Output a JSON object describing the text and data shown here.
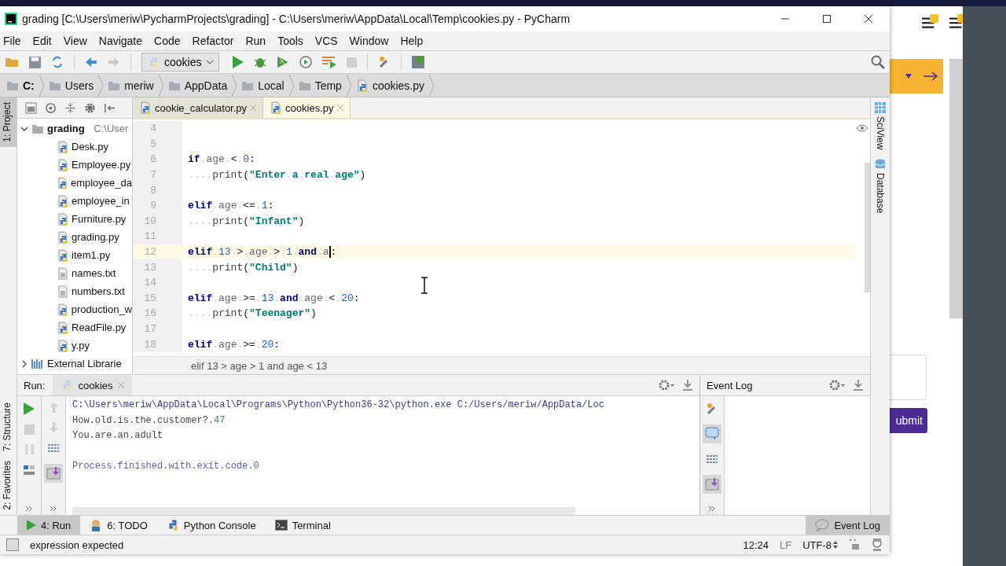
{
  "window": {
    "title": "grading [C:\\Users\\meriw\\PycharmProjects\\grading] - C:\\Users\\meriw\\AppData\\Local\\Temp\\cookies.py - PyCharm"
  },
  "menu": [
    "File",
    "Edit",
    "View",
    "Navigate",
    "Code",
    "Refactor",
    "Run",
    "Tools",
    "VCS",
    "Window",
    "Help"
  ],
  "toolbar": {
    "run_config": "cookies"
  },
  "breadcrumbs": [
    {
      "label": "C:",
      "kind": "drive"
    },
    {
      "label": "Users",
      "kind": "folder"
    },
    {
      "label": "meriw",
      "kind": "folder"
    },
    {
      "label": "AppData",
      "kind": "folder"
    },
    {
      "label": "Local",
      "kind": "folder"
    },
    {
      "label": "Temp",
      "kind": "folder"
    },
    {
      "label": "cookies.py",
      "kind": "python"
    }
  ],
  "side_tabs_left": [
    {
      "label": "1: Project",
      "selected": true
    },
    {
      "label": "7: Structure",
      "selected": false
    },
    {
      "label": "2: Favorites",
      "selected": false
    }
  ],
  "project": {
    "root": {
      "name": "grading",
      "path": "C:\\User",
      "expanded": true,
      "children": [
        {
          "name": "Desk.py",
          "kind": "python"
        },
        {
          "name": "Employee.py",
          "kind": "python"
        },
        {
          "name": "employee_da",
          "kind": "python"
        },
        {
          "name": "employee_in",
          "kind": "python"
        },
        {
          "name": "Furniture.py",
          "kind": "python"
        },
        {
          "name": "grading.py",
          "kind": "python"
        },
        {
          "name": "item1.py",
          "kind": "python"
        },
        {
          "name": "names.txt",
          "kind": "text"
        },
        {
          "name": "numbers.txt",
          "kind": "text"
        },
        {
          "name": "production_w",
          "kind": "python"
        },
        {
          "name": "ReadFile.py",
          "kind": "python"
        },
        {
          "name": "y.py",
          "kind": "python"
        }
      ]
    },
    "libraries": {
      "name": "External Librarie",
      "expanded": false
    }
  },
  "editor": {
    "tabs": [
      {
        "label": "cookie_calculator.py",
        "selected": false
      },
      {
        "label": "cookies.py",
        "selected": true
      }
    ],
    "lines": [
      {
        "number": "4",
        "current": false,
        "caret": false
      },
      {
        "number": "5",
        "current": false,
        "caret": false
      },
      {
        "number": "6",
        "current": false,
        "caret": false,
        "tokens": [
          {
            "kind": "kw",
            "text": "if"
          },
          {
            "kind": "ws",
            "text": "."
          },
          {
            "kind": "id",
            "text": "age"
          },
          {
            "kind": "ws",
            "text": "."
          },
          {
            "kind": "op",
            "text": "<"
          },
          {
            "kind": "ws",
            "text": "."
          },
          {
            "kind": "num",
            "text": "0"
          },
          {
            "kind": "op",
            "text": ":"
          }
        ]
      },
      {
        "number": "7",
        "current": false,
        "caret": false,
        "tokens": [
          {
            "kind": "ws",
            "text": "...."
          },
          {
            "kind": "fn",
            "text": "print"
          },
          {
            "kind": "op",
            "text": "("
          },
          {
            "kind": "str",
            "text": "\"Enter"
          },
          {
            "kind": "ws",
            "text": "."
          },
          {
            "kind": "str",
            "text": "a"
          },
          {
            "kind": "ws",
            "text": "."
          },
          {
            "kind": "str",
            "text": "real"
          },
          {
            "kind": "ws",
            "text": "."
          },
          {
            "kind": "str",
            "text": "age\""
          },
          {
            "kind": "op",
            "text": ")"
          }
        ]
      },
      {
        "number": "8",
        "current": false,
        "caret": false
      },
      {
        "number": "9",
        "current": false,
        "caret": false,
        "tokens": [
          {
            "kind": "kw",
            "text": "elif"
          },
          {
            "kind": "ws",
            "text": "."
          },
          {
            "kind": "id",
            "text": "age"
          },
          {
            "kind": "ws",
            "text": "."
          },
          {
            "kind": "op",
            "text": "<="
          },
          {
            "kind": "ws",
            "text": "."
          },
          {
            "kind": "num",
            "text": "1"
          },
          {
            "kind": "op",
            "text": ":"
          }
        ]
      },
      {
        "number": "10",
        "current": false,
        "caret": false,
        "tokens": [
          {
            "kind": "ws",
            "text": "...."
          },
          {
            "kind": "fn",
            "text": "print"
          },
          {
            "kind": "op",
            "text": "("
          },
          {
            "kind": "str",
            "text": "\"Infant\""
          },
          {
            "kind": "op",
            "text": ")"
          }
        ]
      },
      {
        "number": "11",
        "current": false,
        "caret": false
      },
      {
        "number": "12",
        "current": true,
        "caret": true,
        "tokens": [
          {
            "kind": "kw",
            "text": "elif"
          },
          {
            "kind": "ws",
            "text": "."
          },
          {
            "kind": "num",
            "text": "13"
          },
          {
            "kind": "ws",
            "text": "."
          },
          {
            "kind": "op",
            "text": ">"
          },
          {
            "kind": "ws",
            "text": "."
          },
          {
            "kind": "id",
            "text": "age"
          },
          {
            "kind": "ws",
            "text": "."
          },
          {
            "kind": "op",
            "text": ">"
          },
          {
            "kind": "ws",
            "text": "."
          },
          {
            "kind": "num",
            "text": "1"
          },
          {
            "kind": "ws",
            "text": "."
          },
          {
            "kind": "kw",
            "text": "and"
          },
          {
            "kind": "ws",
            "text": "."
          },
          {
            "kind": "id",
            "text": "a"
          },
          {
            "kind": "op",
            "text": ":"
          }
        ]
      },
      {
        "number": "13",
        "current": false,
        "caret": false,
        "tokens": [
          {
            "kind": "ws",
            "text": "...."
          },
          {
            "kind": "fn",
            "text": "print"
          },
          {
            "kind": "op",
            "text": "("
          },
          {
            "kind": "str",
            "text": "\"Child\""
          },
          {
            "kind": "op",
            "text": ")"
          }
        ]
      },
      {
        "number": "14",
        "current": false,
        "caret": false
      },
      {
        "number": "15",
        "current": false,
        "caret": false,
        "tokens": [
          {
            "kind": "kw",
            "text": "elif"
          },
          {
            "kind": "ws",
            "text": "."
          },
          {
            "kind": "id",
            "text": "age"
          },
          {
            "kind": "ws",
            "text": "."
          },
          {
            "kind": "op",
            "text": ">="
          },
          {
            "kind": "ws",
            "text": "."
          },
          {
            "kind": "num",
            "text": "13"
          },
          {
            "kind": "ws",
            "text": "."
          },
          {
            "kind": "kw",
            "text": "and"
          },
          {
            "kind": "ws",
            "text": "."
          },
          {
            "kind": "id",
            "text": "age"
          },
          {
            "kind": "ws",
            "text": "."
          },
          {
            "kind": "op",
            "text": "<"
          },
          {
            "kind": "ws",
            "text": "."
          },
          {
            "kind": "num",
            "text": "20"
          },
          {
            "kind": "op",
            "text": ":"
          }
        ]
      },
      {
        "number": "16",
        "current": false,
        "caret": false,
        "tokens": [
          {
            "kind": "ws",
            "text": "...."
          },
          {
            "kind": "fn",
            "text": "print"
          },
          {
            "kind": "op",
            "text": "("
          },
          {
            "kind": "str",
            "text": "\"Teenager\""
          },
          {
            "kind": "op",
            "text": ")"
          }
        ]
      },
      {
        "number": "17",
        "current": false,
        "caret": false
      },
      {
        "number": "18",
        "current": false,
        "caret": false,
        "tokens": [
          {
            "kind": "kw",
            "text": "elif"
          },
          {
            "kind": "ws",
            "text": "."
          },
          {
            "kind": "id",
            "text": "age"
          },
          {
            "kind": "ws",
            "text": "."
          },
          {
            "kind": "op",
            "text": ">="
          },
          {
            "kind": "ws",
            "text": "."
          },
          {
            "kind": "num",
            "text": "20"
          },
          {
            "kind": "op",
            "text": ":"
          }
        ]
      }
    ],
    "breadcrumb": "elif 13 > age > 1 and age < 13"
  },
  "side_tabs_right": [
    "SciView",
    "Database"
  ],
  "run": {
    "title": "Run:",
    "tab": "cookies",
    "console": [
      {
        "kind": "command",
        "text": "C:\\Users\\meriw\\AppData\\Local\\Programs\\Python\\Python36-32\\python.exe C:/Users/meriw/AppData/Loc"
      },
      {
        "kind": "output",
        "text": "How.old.is.the.customer?.",
        "input": "47"
      },
      {
        "kind": "output",
        "text": "You.are.an.adult"
      },
      {
        "kind": "blank"
      },
      {
        "kind": "system",
        "text": "Process.finished.with.exit.code.0"
      }
    ]
  },
  "event_log": {
    "title": "Event Log"
  },
  "tool_tabs": [
    {
      "label": "4: Run",
      "kind": "run",
      "selected": true
    },
    {
      "label": "6: TODO",
      "kind": "todo",
      "selected": false
    },
    {
      "label": "Python Console",
      "kind": "console",
      "selected": false
    },
    {
      "label": "Terminal",
      "kind": "terminal",
      "selected": false
    }
  ],
  "tool_tab_right": {
    "label": "Event Log",
    "selected": true
  },
  "status": {
    "message": "expression expected",
    "position": "12:24",
    "line_separator": "LF",
    "encoding": "UTF-8"
  },
  "background": {
    "button": "ubmit"
  }
}
